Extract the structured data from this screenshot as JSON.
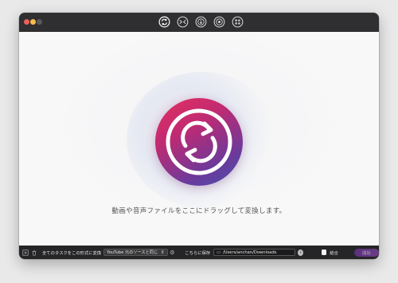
{
  "window": {
    "tabs": [
      {
        "name": "convert",
        "icon": "convert-icon",
        "active": true
      },
      {
        "name": "compress",
        "icon": "compress-icon",
        "active": false
      },
      {
        "name": "download",
        "icon": "download-icon",
        "active": false
      },
      {
        "name": "record",
        "icon": "record-icon",
        "active": false
      },
      {
        "name": "toolbox",
        "icon": "toolbox-icon",
        "active": false
      }
    ]
  },
  "main": {
    "hero_icon": "convert-arrows-icon",
    "drop_text": "動画や音声ファイルをここにドラッグして変換します。"
  },
  "toolbar": {
    "convert_all_label": "全てのタスクをこの形式に変換",
    "format_select_value": "YouTube 元のソースと同じ",
    "save_to_label": "こちらに保存",
    "output_path": "/Users/anchan/Downloads",
    "merge_label": "結合",
    "start_label": "開始"
  },
  "colors": {
    "titlebar": "#2f2f31",
    "toolbar": "#252527",
    "hero_gradient_start": "#e6305f",
    "hero_gradient_end": "#4a4fae",
    "start_button": "#5a2e7a"
  }
}
